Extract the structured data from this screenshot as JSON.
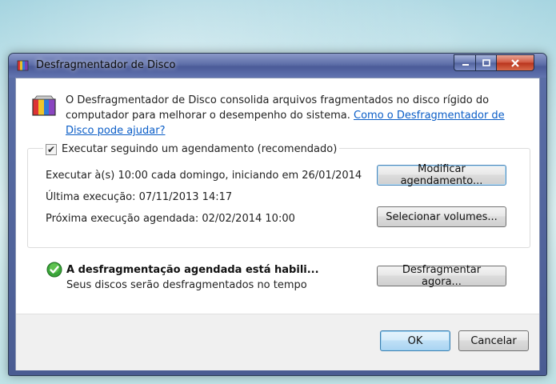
{
  "window": {
    "title": "Desfragmentador de Disco",
    "controls": {
      "minimize": "—",
      "maximize": "□",
      "close": "✕"
    }
  },
  "intro": {
    "text": "O Desfragmentador de Disco consolida arquivos fragmentados no disco rígido do computador para melhorar o desempenho do sistema.",
    "link": "Como o Desfragmentador de Disco pode ajudar?"
  },
  "schedule": {
    "checkbox_label": "Executar seguindo um agendamento (recomendado)",
    "checked": true,
    "run_at": "Executar à(s) 10:00 cada domingo, iniciando em 26/01/2014",
    "last_run": "Última execução: 07/11/2013 14:17",
    "next_run": "Próxima execução agendada: 02/02/2014 10:00",
    "modify_button": "Modificar agendamento...",
    "select_volumes_button": "Selecionar volumes..."
  },
  "status": {
    "title": "A desfragmentação agendada está habili...",
    "subtitle": "Seus discos serão desfragmentados no tempo"
  },
  "actions": {
    "defrag_now_button": "Desfragmentar agora...",
    "ok_button": "OK",
    "cancel_button": "Cancelar"
  },
  "icons": {
    "app": "defrag-icon",
    "hero": "defrag-icon",
    "status": "green-check-shield-icon"
  },
  "colors": {
    "link": "#0a5dc7",
    "titlebar": "#5d6ea8",
    "default_button_border": "#3c7fb1"
  }
}
